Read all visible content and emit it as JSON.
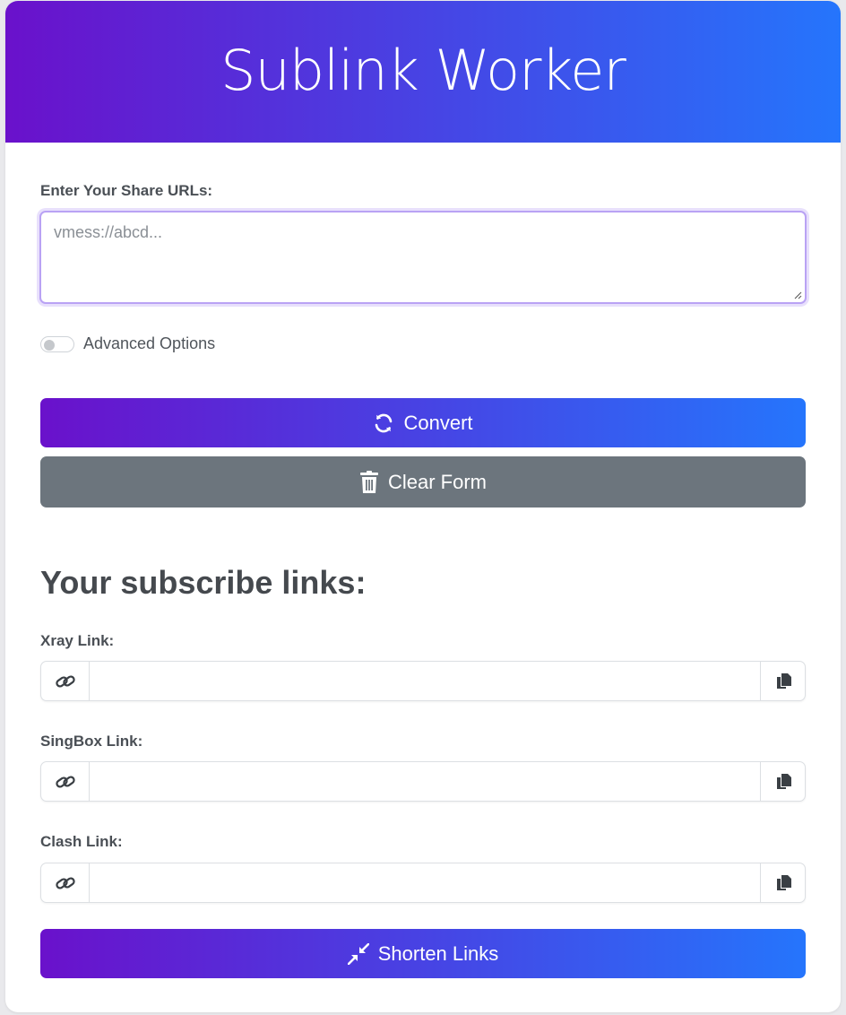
{
  "header": {
    "title": "Sublink Worker"
  },
  "form": {
    "share_urls_label": "Enter Your Share URLs:",
    "share_urls_placeholder": "vmess://abcd...",
    "share_urls_value": "",
    "advanced_options_label": "Advanced Options",
    "advanced_options_enabled": false,
    "convert_label": "Convert",
    "clear_label": "Clear Form"
  },
  "results": {
    "title": "Your subscribe links:",
    "links": [
      {
        "label": "Xray Link:",
        "value": ""
      },
      {
        "label": "SingBox Link:",
        "value": ""
      },
      {
        "label": "Clash Link:",
        "value": ""
      }
    ],
    "shorten_label": "Shorten Links"
  },
  "colors": {
    "gradient_start": "#6a11cb",
    "gradient_end": "#2575fc",
    "secondary_button": "#6c757d",
    "focus_border": "#b9a2f4"
  },
  "icons": {
    "convert": "sync-icon",
    "clear": "trash-icon",
    "link": "link-icon",
    "copy": "copy-icon",
    "shorten": "compress-icon"
  }
}
